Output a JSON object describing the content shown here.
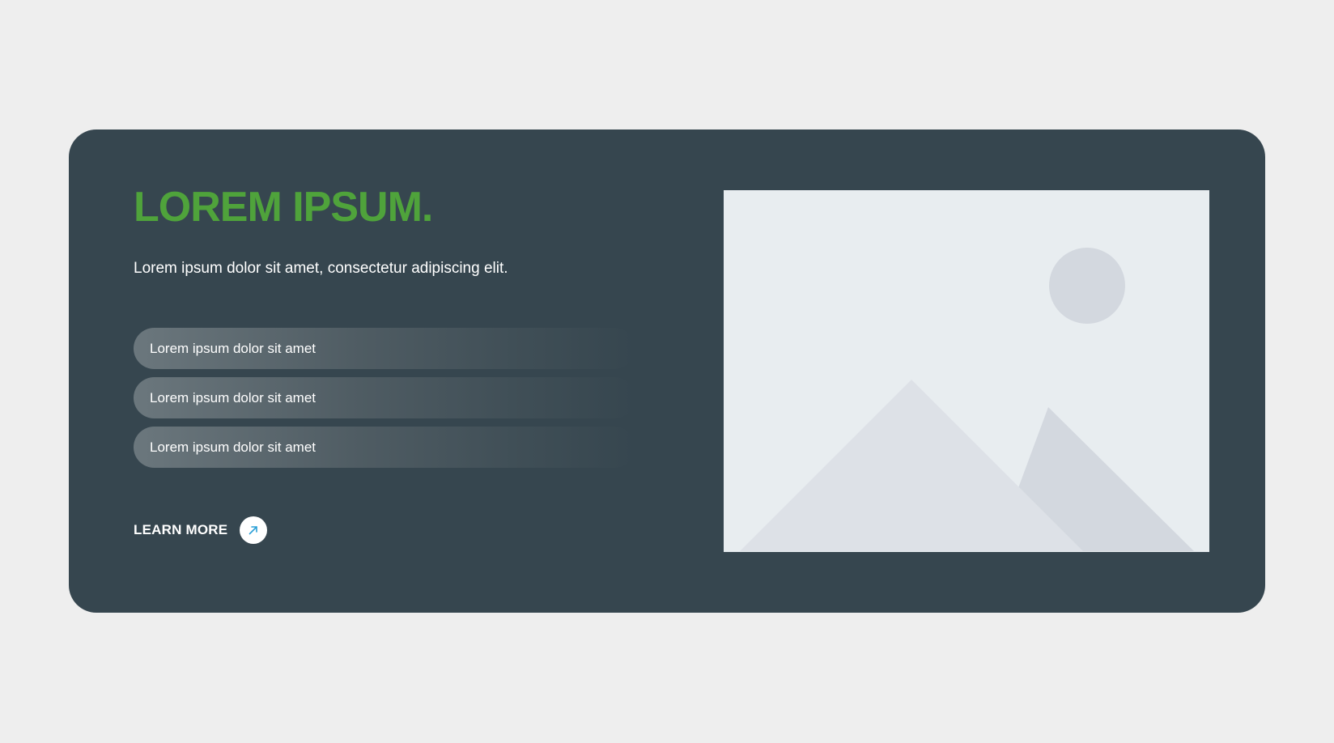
{
  "hero": {
    "title": "LOREM IPSUM.",
    "subtitle": "Lorem ipsum dolor sit amet, consectetur adipiscing elit.",
    "items": [
      {
        "label": "Lorem ipsum dolor sit amet"
      },
      {
        "label": "Lorem ipsum dolor sit amet"
      },
      {
        "label": "Lorem ipsum dolor sit amet"
      }
    ],
    "cta": {
      "label": "LEARN MORE",
      "icon": "arrow-up-right-icon"
    },
    "image": {
      "icon": "image-placeholder-icon"
    }
  },
  "colors": {
    "page_background": "#eeeeee",
    "card_background": "#36464f",
    "accent_green": "#4fa33b",
    "accent_blue": "#2a9fd6",
    "text_white": "#ffffff",
    "placeholder_background": "#e8edf0"
  }
}
